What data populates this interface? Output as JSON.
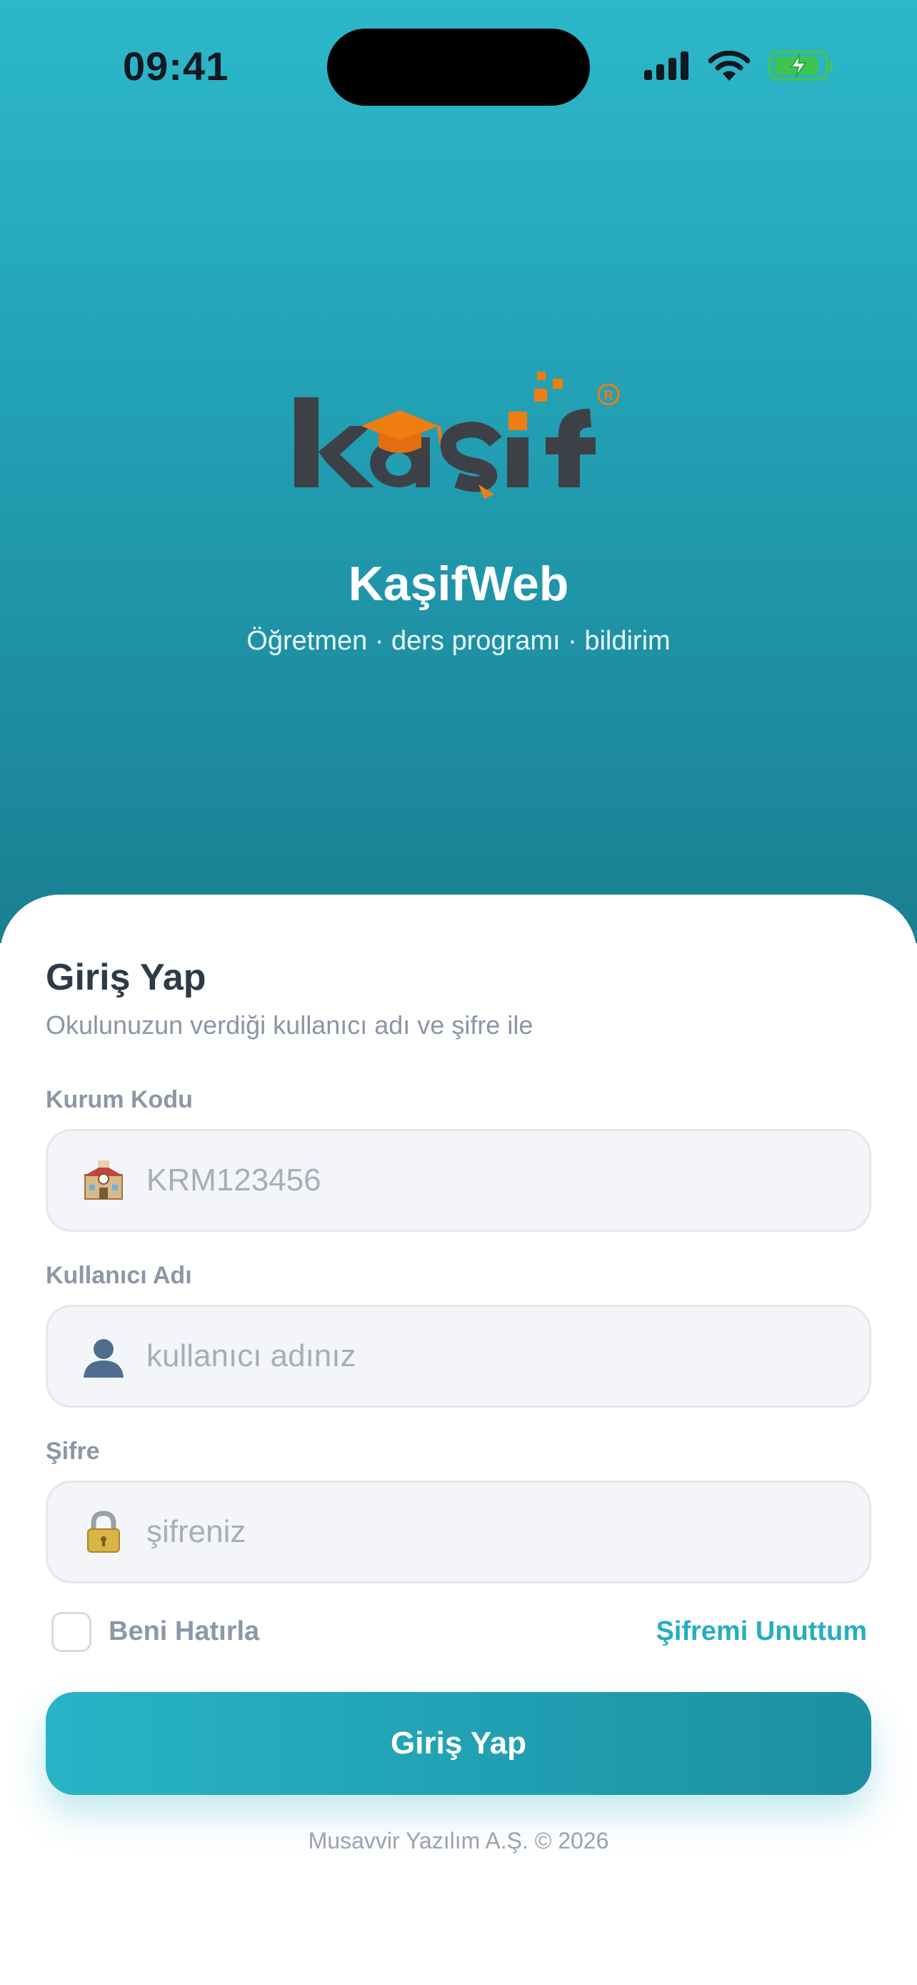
{
  "status_bar": {
    "time": "09:41",
    "icons": [
      "cellular-signal-icon",
      "wifi-icon",
      "battery-charging-icon"
    ]
  },
  "brand": {
    "logo_text": "kaşif",
    "app_name": "KaşifWeb",
    "tagline": "Öğretmen · ders programı · bildirim",
    "colors": {
      "gradient_top": "#2cb8c9",
      "gradient_bottom": "#1a7f92",
      "logo_dark": "#3d4147",
      "logo_orange": "#f07d12",
      "accent": "#25adc2"
    }
  },
  "login": {
    "title": "Giriş Yap",
    "subtitle": "Okulunuzun verdiği kullanıcı adı ve şifre ile",
    "fields": [
      {
        "label": "Kurum Kodu",
        "placeholder": "KRM123456",
        "icon": "school-building-icon"
      },
      {
        "label": "Kullanıcı Adı",
        "placeholder": "kullanıcı adınız",
        "icon": "user-silhouette-icon"
      },
      {
        "label": "Şifre",
        "placeholder": "şifreniz",
        "icon": "lock-icon"
      }
    ],
    "remember_me": {
      "label": "Beni Hatırla",
      "checked": false
    },
    "forgot_password": "Şifremi Unuttum",
    "submit_label": "Giriş Yap"
  },
  "footer": {
    "text": "Musavvir Yazılım A.Ş. © 2026"
  }
}
